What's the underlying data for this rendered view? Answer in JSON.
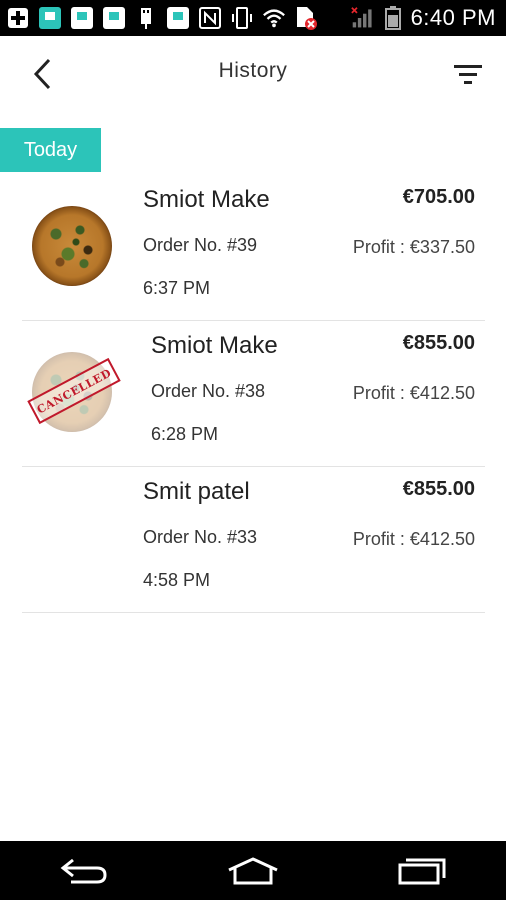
{
  "status_bar": {
    "time": "6:40 PM",
    "icons": [
      "plus-icon",
      "app-icon",
      "app-icon",
      "app-icon",
      "app-icon",
      "usb-icon",
      "app-icon",
      "nfc-icon",
      "vibrate-icon",
      "wifi-icon",
      "sim-error-icon",
      "signal-icon",
      "battery-icon"
    ]
  },
  "header": {
    "title": "History",
    "back_icon": "chevron-left-icon",
    "filter_icon": "filter-icon"
  },
  "section": {
    "label": "Today",
    "color": "#2cc4b9"
  },
  "orders": [
    {
      "name": "Smiot Make",
      "order_no": "Order No. #39",
      "time": "6:37 PM",
      "amount": "€705.00",
      "profit": "Profit : €337.50",
      "thumb": "pizza",
      "status_stamp": ""
    },
    {
      "name": "Smiot Make",
      "order_no": "Order No. #38",
      "time": "6:28 PM",
      "amount": "€855.00",
      "profit": "Profit : €412.50",
      "thumb": "pizza-cancelled",
      "status_stamp": "CANCELLED"
    },
    {
      "name": "Smit patel",
      "order_no": "Order No. #33",
      "time": "4:58 PM",
      "amount": "€855.00",
      "profit": "Profit : €412.50",
      "thumb": "none",
      "status_stamp": ""
    }
  ],
  "nav": {
    "back_icon": "back-icon",
    "home_icon": "home-icon",
    "recents_icon": "recents-icon"
  }
}
